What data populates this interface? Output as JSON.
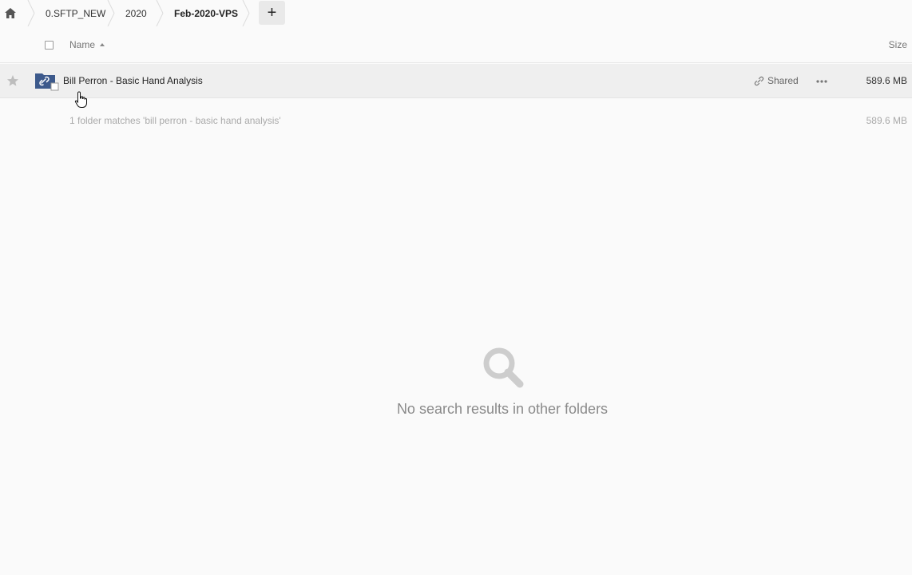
{
  "breadcrumb": {
    "items": [
      "0.SFTP_NEW",
      "2020",
      "Feb-2020-VPS"
    ],
    "add_label": "+"
  },
  "header": {
    "name_label": "Name",
    "size_label": "Size"
  },
  "file": {
    "name": "Bill Perron - Basic Hand Analysis",
    "shared_label": "Shared",
    "size": "589.6 MB"
  },
  "summary": {
    "text": "1 folder matches 'bill perron - basic hand analysis'",
    "size": "589.6 MB"
  },
  "empty_state": {
    "text": "No search results in other folders",
    "icon": "search-icon"
  },
  "colors": {
    "accent": "#3d5a8c",
    "background": "#fafafa",
    "row_highlight": "#efefef"
  }
}
